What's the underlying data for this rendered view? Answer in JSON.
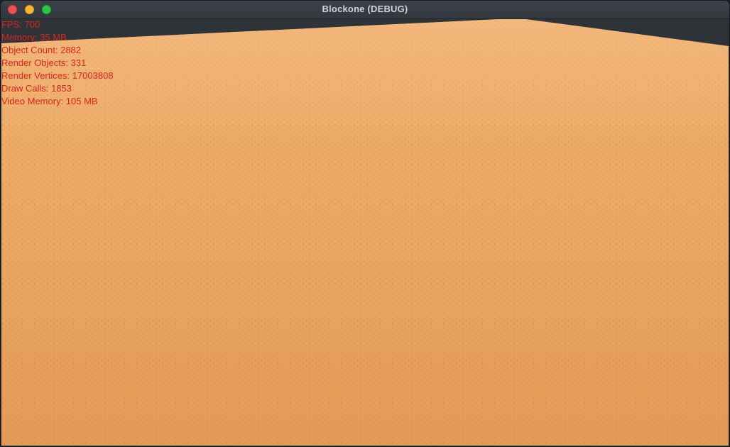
{
  "window": {
    "title": "Blockone (DEBUG)",
    "controls": {
      "close": "close-button",
      "minimize": "minimize-button",
      "maximize": "maximize-button"
    }
  },
  "scene": {
    "sky_color": "#2e3338",
    "ground_color": "#e8a460",
    "ground_texture": "sand"
  },
  "debug_overlay": {
    "text_color": "#e0241b",
    "fps": "FPS: 700",
    "memory": "Memory: 35 MB",
    "object_count": "Object Count: 2882",
    "render_objects": "Render Objects: 331",
    "render_vertices": "Render Vertices: 17003808",
    "draw_calls": "Draw Calls: 1853",
    "video_memory": "Video Memory: 105 MB"
  }
}
